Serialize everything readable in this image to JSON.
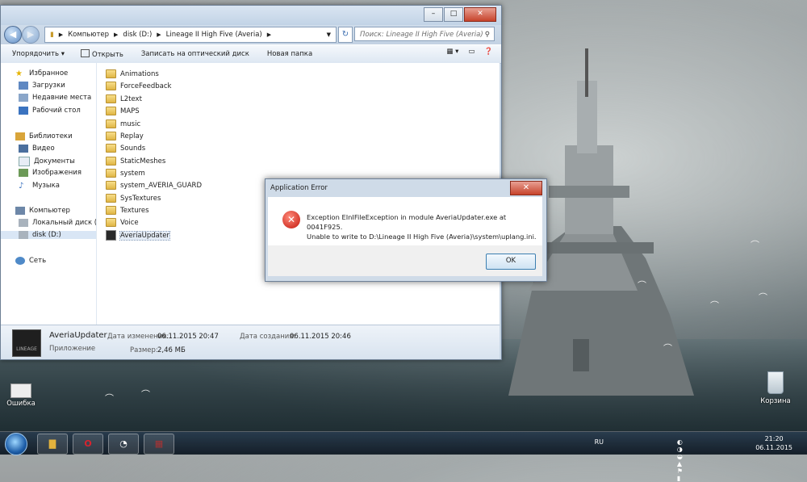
{
  "window": {
    "address": [
      "Компьютер",
      "disk (D:)",
      "Lineage II High Five (Averia)"
    ],
    "search_placeholder": "Поиск: Lineage II High Five (Averia)"
  },
  "toolbar": {
    "organize": "Упорядочить ▾",
    "open": "Открыть",
    "burn": "Записать на оптический диск",
    "new_folder": "Новая папка"
  },
  "nav": {
    "favorites": "Избранное",
    "downloads": "Загрузки",
    "recent": "Недавние места",
    "desktop": "Рабочий стол",
    "libraries": "Библиотеки",
    "video": "Видео",
    "documents": "Документы",
    "images": "Изображения",
    "music": "Музыка",
    "computer": "Компьютер",
    "local_disk": "Локальный диск (C",
    "disk_d": "disk (D:)",
    "network": "Сеть"
  },
  "files": [
    "Animations",
    "ForceFeedback",
    "L2text",
    "MAPS",
    "music",
    "Replay",
    "Sounds",
    "StaticMeshes",
    "system",
    "system_AVERIA_GUARD",
    "SysTextures",
    "Textures",
    "Voice",
    "AveriaUpdater"
  ],
  "details": {
    "name": "AveriaUpdater",
    "type": "Приложение",
    "modified_label": "Дата изменения:",
    "modified": "06.11.2015 20:47",
    "created_label": "Дата создания:",
    "created": "06.11.2015 20:46",
    "size_label": "Размер:",
    "size": "2,46 МБ",
    "thumb_text": "LINEAGE"
  },
  "dialog": {
    "title": "Application Error",
    "line1": "Exception EInIFileException in module AveriaUpdater.exe at 0041F925.",
    "line2": "Unable to write to D:\\Lineage II High Five (Averia)\\system\\uplang.ini.",
    "ok": "OK"
  },
  "desktop": {
    "error_icon_label": "Ошибка",
    "recycle_label": "Корзина"
  },
  "taskbar": {
    "lang": "RU",
    "time": "21:20",
    "date": "06.11.2015"
  }
}
